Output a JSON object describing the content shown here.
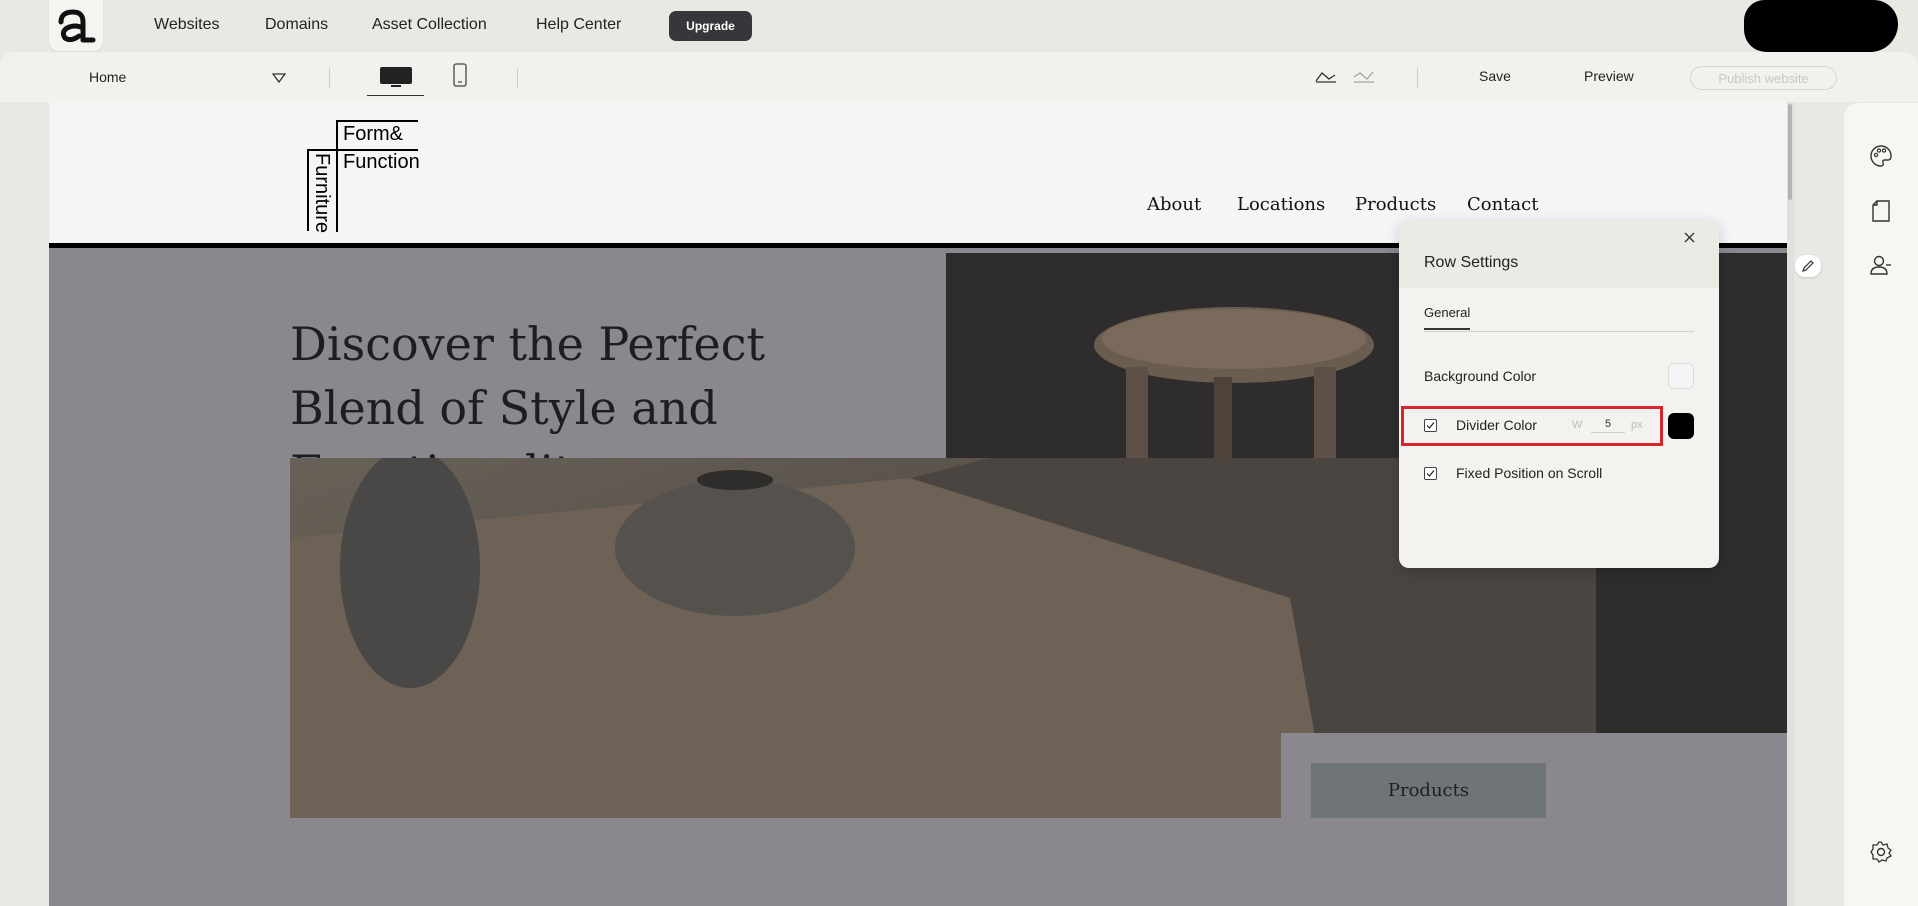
{
  "topbar": {
    "nav": [
      "Websites",
      "Domains",
      "Asset Collection",
      "Help Center"
    ],
    "upgrade_label": "Upgrade"
  },
  "toolbar": {
    "page_name": "Home",
    "save_label": "Save",
    "preview_label": "Preview",
    "publish_label": "Publish website"
  },
  "site": {
    "brand": {
      "line1": "Form&",
      "line2": "Function",
      "vertical": "Furniture"
    },
    "nav": [
      "About",
      "Locations",
      "Products",
      "Contact"
    ],
    "hero_title": "Discover the Perfect Blend of Style and Functionality",
    "cta_label": "Products"
  },
  "row_settings": {
    "title": "Row Settings",
    "tab": "General",
    "background_color_label": "Background Color",
    "background_color": "#f3f5f7",
    "divider_color_label": "Divider Color",
    "divider_enabled": true,
    "divider_width_prefix": "W",
    "divider_width": "5",
    "divider_width_unit": "px",
    "divider_color": "#000000",
    "fixed_position_label": "Fixed Position on Scroll",
    "fixed_position_enabled": true
  },
  "icons": [
    "app-logo-icon",
    "dropdown-icon",
    "desktop-icon",
    "mobile-icon",
    "undo-icon",
    "redo-icon",
    "close-icon",
    "checkbox-icon",
    "pencil-icon",
    "palette-icon",
    "page-icon",
    "users-icon",
    "settings-icon"
  ]
}
